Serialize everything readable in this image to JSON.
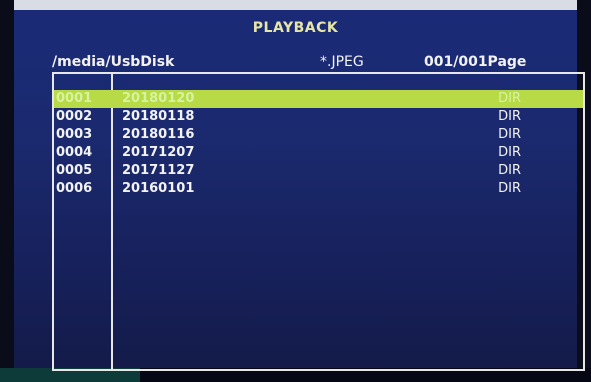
{
  "screen": {
    "title": "PLAYBACK",
    "path": "/media/UsbDisk",
    "filter": "*.JPEG",
    "page": "001/001Page"
  },
  "files": [
    {
      "index": "0001",
      "name": "20180120",
      "type": "DIR",
      "selected": true
    },
    {
      "index": "0002",
      "name": "20180118",
      "type": "DIR",
      "selected": false
    },
    {
      "index": "0003",
      "name": "20180116",
      "type": "DIR",
      "selected": false
    },
    {
      "index": "0004",
      "name": "20171207",
      "type": "DIR",
      "selected": false
    },
    {
      "index": "0005",
      "name": "20171127",
      "type": "DIR",
      "selected": false
    },
    {
      "index": "0006",
      "name": "20160101",
      "type": "DIR",
      "selected": false
    }
  ],
  "colors": {
    "background": "#1a2a76",
    "selected_row": "#b7da46",
    "title": "#e7e6a6",
    "text": "#f3f3f3",
    "border": "#e7e7e7"
  }
}
